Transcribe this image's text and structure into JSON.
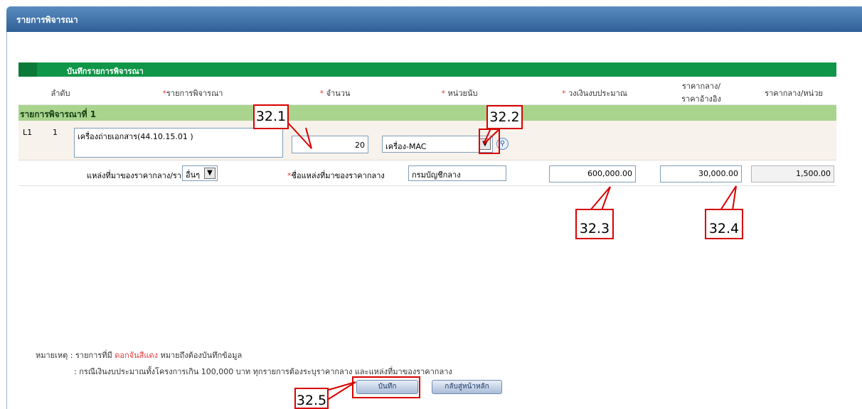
{
  "header": {
    "title": "รายการพิจารณา"
  },
  "section": {
    "title": "บันทึกรายการพิจารณา"
  },
  "columns": {
    "seq": "ลำดับ",
    "item": "รายการพิจารณา",
    "qty": "จำนวน",
    "unit": "หน่วยนับ",
    "budget": "วงเงินงบประมาณ",
    "median_line1": "ราคากลาง/",
    "median_line2": "ราคาอ้างอิง",
    "unit_price": "ราคากลาง/หน่วย"
  },
  "group": {
    "label": "รายการพิจารณาที่ 1"
  },
  "row": {
    "code": "L1",
    "seq": "1",
    "item_text": "เครื่องถ่ายเอกสาร(44.10.15.01 )",
    "qty_value": "20",
    "unit_value": "เครื่อง-MAC",
    "source_label": "แหล่งที่มาของราคากลาง/ราคาอ้างอิง",
    "source_value": "อื่นๆ",
    "source_name_label": "ชื่อแหล่งที่มาของราคากลาง",
    "source_name_value": "กรมบัญชีกลาง",
    "budget_value": "600,000.00",
    "median_value": "30,000.00",
    "unit_price_value": "1,500.00"
  },
  "notes": {
    "prefix": "หมายเหตุ : รายการที่มี",
    "red_text": "ดอกจันสีแดง",
    "suffix": "หมายถึงต้องบันทึกข้อมูล",
    "line2": ": กรณีเงินงบประมาณทั้งโครงการเกิน 100,000 บาท ทุกรายการต้องระบุราคากลาง และแหล่งที่มาของราคากลาง"
  },
  "buttons": {
    "save": "บันทึก",
    "back": "กลับสู่หน้าหลัก"
  },
  "callouts": {
    "c1": "32.1",
    "c2": "32.2",
    "c3": "32.3",
    "c4": "32.4",
    "c5": "32.5"
  },
  "colors": {
    "header": "#2f5f97",
    "section_bar": "#0f9648",
    "group_row": "#a9d48d",
    "callout": "#d90000",
    "required": "#e23a3a"
  },
  "icons": {
    "dropdown": "chevron-down-icon",
    "search": "search-icon"
  }
}
